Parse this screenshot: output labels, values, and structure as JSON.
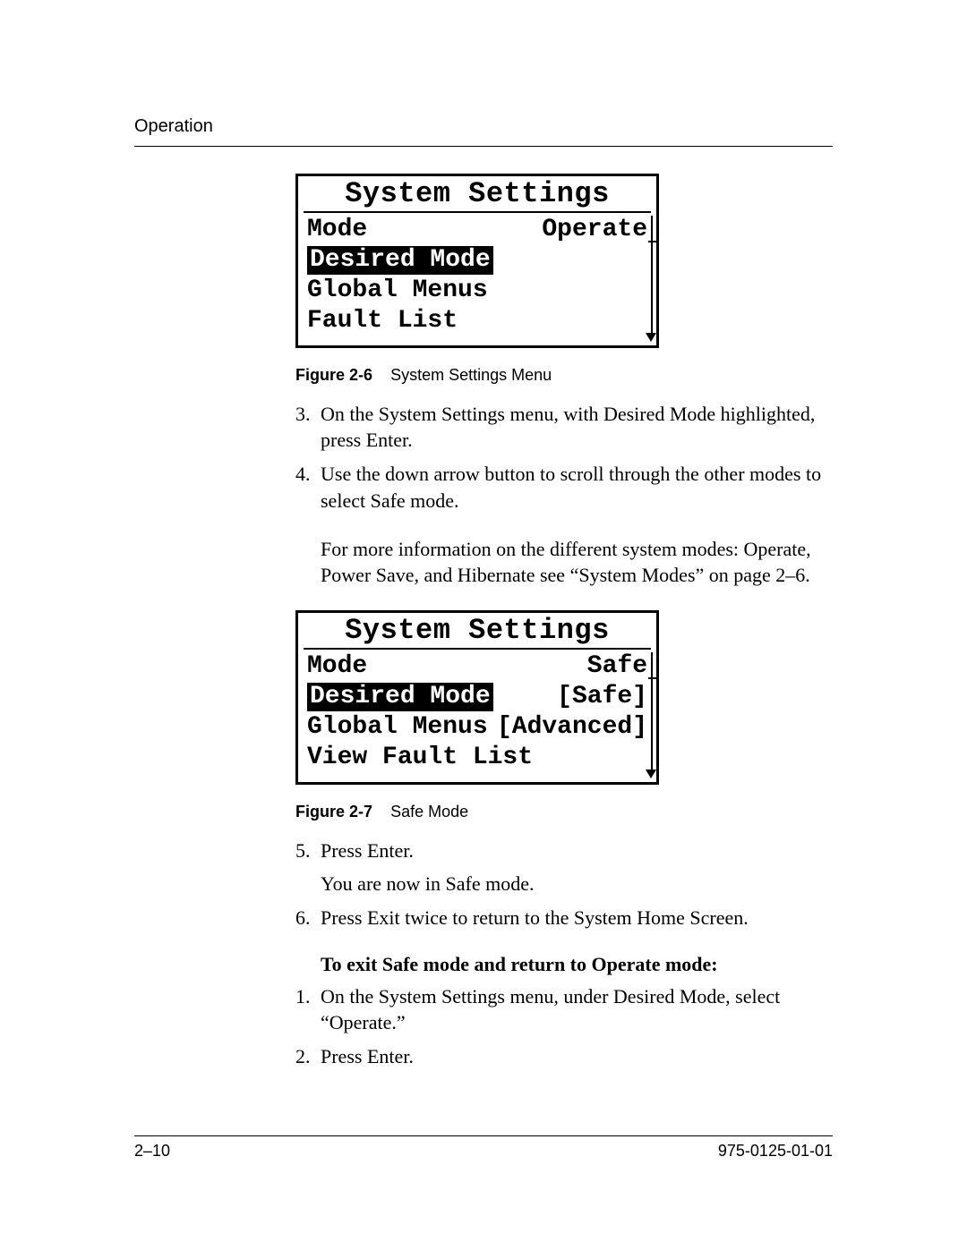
{
  "header": {
    "section": "Operation"
  },
  "panel1": {
    "title": "System Settings",
    "rows": [
      {
        "left": "Mode",
        "right": "Operate",
        "highlight": false
      },
      {
        "left": "Desired Mode",
        "right": "",
        "highlight": true
      },
      {
        "left": "Global Menus",
        "right": "",
        "highlight": false
      },
      {
        "left": "Fault List",
        "right": "",
        "highlight": false
      }
    ]
  },
  "caption1": {
    "label": "Figure 2-6",
    "text": "System Settings Menu"
  },
  "stepsA": [
    {
      "num": "3.",
      "text": "On the System Settings menu, with Desired Mode highlighted, press Enter."
    },
    {
      "num": "4.",
      "text": "Use the down arrow button to scroll through the other modes to select Safe mode."
    }
  ],
  "noteA": "For more information on the different system modes: Operate, Power Save, and Hibernate see “System Modes” on page 2–6.",
  "panel2": {
    "title": "System Settings",
    "rows": [
      {
        "left": "Mode",
        "right": "Safe",
        "highlight": false
      },
      {
        "left": "Desired Mode",
        "right": "[Safe]",
        "highlight": true
      },
      {
        "left": "Global Menus",
        "right": "[Advanced]",
        "highlight": false
      },
      {
        "left": "View Fault List",
        "right": "",
        "highlight": false
      }
    ]
  },
  "caption2": {
    "label": "Figure 2-7",
    "text": "Safe Mode"
  },
  "stepsB": [
    {
      "num": "5.",
      "text": "Press Enter."
    },
    {
      "num": "",
      "text": "You are now in Safe mode."
    },
    {
      "num": "6.",
      "text": "Press Exit twice to return to the System Home Screen."
    }
  ],
  "subhead": "To exit Safe mode and return to Operate mode:",
  "stepsC": [
    {
      "num": "1.",
      "text": "On the System Settings menu, under Desired Mode, select “Operate.”"
    },
    {
      "num": "2.",
      "text": "Press Enter."
    }
  ],
  "footer": {
    "left": "2–10",
    "right": "975-0125-01-01"
  }
}
